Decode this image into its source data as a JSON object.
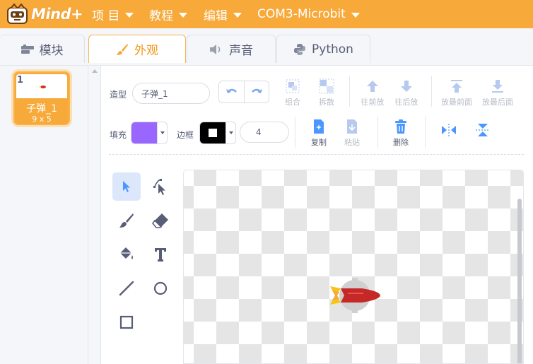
{
  "app": {
    "logo_text": "Mind+",
    "menu": [
      {
        "label": "项 目"
      },
      {
        "label": "教程"
      },
      {
        "label": "编辑"
      },
      {
        "label": "COM3-Microbit"
      }
    ]
  },
  "tabs": [
    {
      "label": "模块",
      "icon": "blocks-icon",
      "active": false
    },
    {
      "label": "外观",
      "icon": "brush-icon",
      "active": true
    },
    {
      "label": "声音",
      "icon": "speaker-icon",
      "active": false
    },
    {
      "label": "Python",
      "icon": "python-icon",
      "active": false
    }
  ],
  "costume_list": {
    "items": [
      {
        "number": "1",
        "name": "子弹_1",
        "size": "9 x 5",
        "selected": true
      }
    ]
  },
  "editor": {
    "costume_label": "造型",
    "costume_name": "子弹_1",
    "toolbar": {
      "group": "组合",
      "ungroup": "拆散",
      "forward": "往前放",
      "backward": "往后放",
      "front": "放最前面",
      "back": "放最后面",
      "copy": "复制",
      "paste": "粘贴",
      "delete": "删除"
    },
    "fill_label": "填充",
    "fill_color": "#9966ff",
    "outline_label": "边框",
    "outline_color": "#000000",
    "outline_width": "4",
    "accent_color": "#f7a93a",
    "icon_blue": "#4c97ff"
  }
}
